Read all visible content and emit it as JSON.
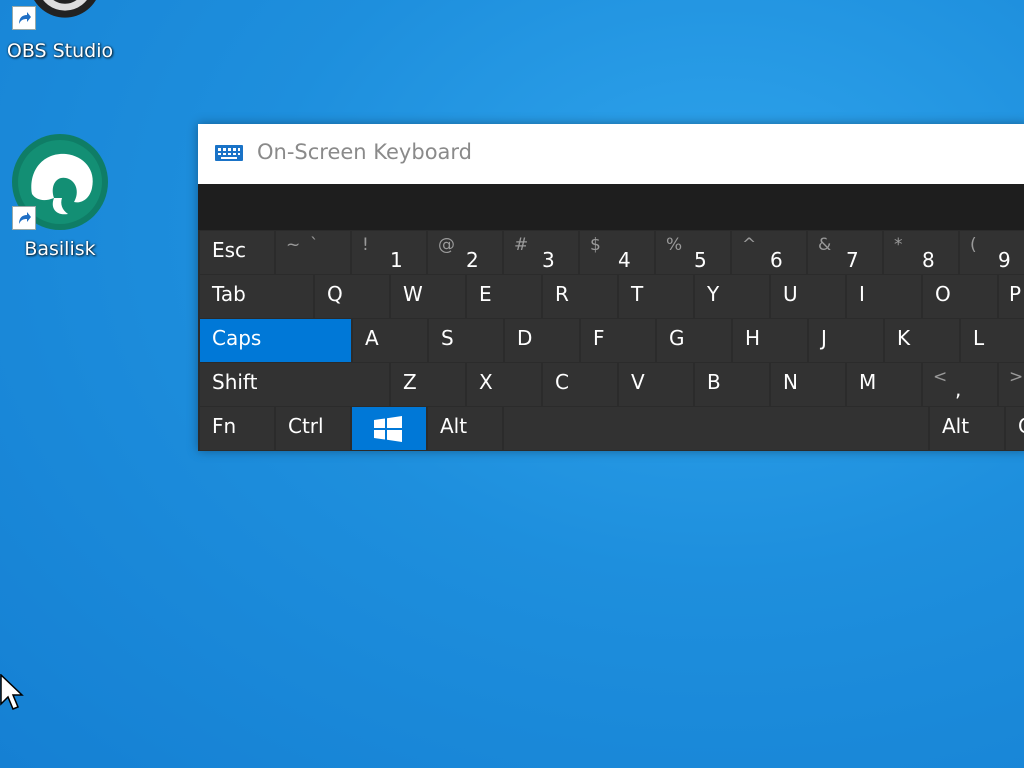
{
  "desktop": {
    "icons": [
      {
        "label": "OBS Studio",
        "icon": "obs-studio-icon"
      },
      {
        "label": "Basilisk",
        "icon": "basilisk-icon"
      }
    ]
  },
  "window": {
    "title": "On-Screen Keyboard",
    "icon": "keyboard-icon"
  },
  "keys": {
    "row1": [
      {
        "main": "Esc"
      },
      {
        "shift": "~",
        "base": "`"
      },
      {
        "shift": "!",
        "base": "1"
      },
      {
        "shift": "@",
        "base": "2"
      },
      {
        "shift": "#",
        "base": "3"
      },
      {
        "shift": "$",
        "base": "4"
      },
      {
        "shift": "%",
        "base": "5"
      },
      {
        "shift": "^",
        "base": "6"
      },
      {
        "shift": "&",
        "base": "7"
      },
      {
        "shift": "*",
        "base": "8"
      },
      {
        "shift": "(",
        "base": "9"
      }
    ],
    "row2": [
      "Tab",
      "Q",
      "W",
      "E",
      "R",
      "T",
      "Y",
      "U",
      "I",
      "O",
      "P"
    ],
    "row3": [
      "Caps",
      "A",
      "S",
      "D",
      "F",
      "G",
      "H",
      "J",
      "K",
      "L"
    ],
    "row4": [
      "Shift",
      "Z",
      "X",
      "C",
      "V",
      "B",
      "N",
      "M"
    ],
    "row4_punct": [
      {
        "shift": "<",
        "base": ","
      },
      {
        "shift": ">",
        "base": ""
      }
    ],
    "row5": {
      "fn": "Fn",
      "ctrl": "Ctrl",
      "win_icon": "windows-logo-icon",
      "alt": "Alt",
      "alt_right": "Alt",
      "partial": "C"
    }
  },
  "colors": {
    "accent": "#0078d7",
    "key": "#323232",
    "frame": "#2b2b2b"
  }
}
